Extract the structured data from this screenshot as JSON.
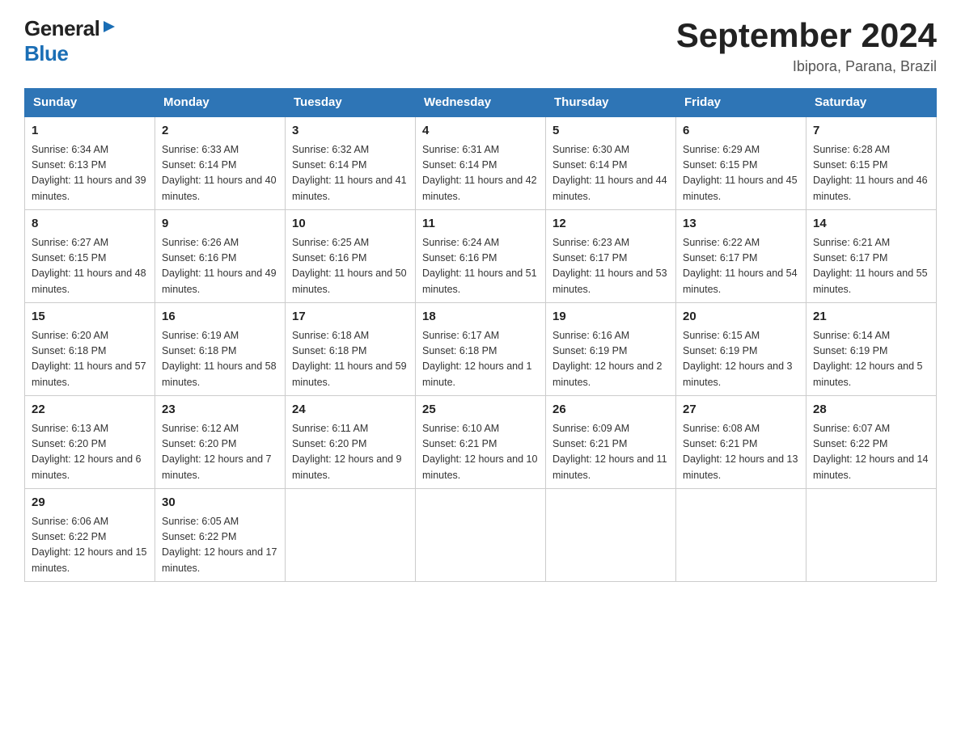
{
  "header": {
    "logo_general": "General",
    "logo_blue": "Blue",
    "main_title": "September 2024",
    "subtitle": "Ibipora, Parana, Brazil"
  },
  "weekdays": [
    "Sunday",
    "Monday",
    "Tuesday",
    "Wednesday",
    "Thursday",
    "Friday",
    "Saturday"
  ],
  "weeks": [
    [
      {
        "day": "1",
        "sunrise": "6:34 AM",
        "sunset": "6:13 PM",
        "daylight": "11 hours and 39 minutes."
      },
      {
        "day": "2",
        "sunrise": "6:33 AM",
        "sunset": "6:14 PM",
        "daylight": "11 hours and 40 minutes."
      },
      {
        "day": "3",
        "sunrise": "6:32 AM",
        "sunset": "6:14 PM",
        "daylight": "11 hours and 41 minutes."
      },
      {
        "day": "4",
        "sunrise": "6:31 AM",
        "sunset": "6:14 PM",
        "daylight": "11 hours and 42 minutes."
      },
      {
        "day": "5",
        "sunrise": "6:30 AM",
        "sunset": "6:14 PM",
        "daylight": "11 hours and 44 minutes."
      },
      {
        "day": "6",
        "sunrise": "6:29 AM",
        "sunset": "6:15 PM",
        "daylight": "11 hours and 45 minutes."
      },
      {
        "day": "7",
        "sunrise": "6:28 AM",
        "sunset": "6:15 PM",
        "daylight": "11 hours and 46 minutes."
      }
    ],
    [
      {
        "day": "8",
        "sunrise": "6:27 AM",
        "sunset": "6:15 PM",
        "daylight": "11 hours and 48 minutes."
      },
      {
        "day": "9",
        "sunrise": "6:26 AM",
        "sunset": "6:16 PM",
        "daylight": "11 hours and 49 minutes."
      },
      {
        "day": "10",
        "sunrise": "6:25 AM",
        "sunset": "6:16 PM",
        "daylight": "11 hours and 50 minutes."
      },
      {
        "day": "11",
        "sunrise": "6:24 AM",
        "sunset": "6:16 PM",
        "daylight": "11 hours and 51 minutes."
      },
      {
        "day": "12",
        "sunrise": "6:23 AM",
        "sunset": "6:17 PM",
        "daylight": "11 hours and 53 minutes."
      },
      {
        "day": "13",
        "sunrise": "6:22 AM",
        "sunset": "6:17 PM",
        "daylight": "11 hours and 54 minutes."
      },
      {
        "day": "14",
        "sunrise": "6:21 AM",
        "sunset": "6:17 PM",
        "daylight": "11 hours and 55 minutes."
      }
    ],
    [
      {
        "day": "15",
        "sunrise": "6:20 AM",
        "sunset": "6:18 PM",
        "daylight": "11 hours and 57 minutes."
      },
      {
        "day": "16",
        "sunrise": "6:19 AM",
        "sunset": "6:18 PM",
        "daylight": "11 hours and 58 minutes."
      },
      {
        "day": "17",
        "sunrise": "6:18 AM",
        "sunset": "6:18 PM",
        "daylight": "11 hours and 59 minutes."
      },
      {
        "day": "18",
        "sunrise": "6:17 AM",
        "sunset": "6:18 PM",
        "daylight": "12 hours and 1 minute."
      },
      {
        "day": "19",
        "sunrise": "6:16 AM",
        "sunset": "6:19 PM",
        "daylight": "12 hours and 2 minutes."
      },
      {
        "day": "20",
        "sunrise": "6:15 AM",
        "sunset": "6:19 PM",
        "daylight": "12 hours and 3 minutes."
      },
      {
        "day": "21",
        "sunrise": "6:14 AM",
        "sunset": "6:19 PM",
        "daylight": "12 hours and 5 minutes."
      }
    ],
    [
      {
        "day": "22",
        "sunrise": "6:13 AM",
        "sunset": "6:20 PM",
        "daylight": "12 hours and 6 minutes."
      },
      {
        "day": "23",
        "sunrise": "6:12 AM",
        "sunset": "6:20 PM",
        "daylight": "12 hours and 7 minutes."
      },
      {
        "day": "24",
        "sunrise": "6:11 AM",
        "sunset": "6:20 PM",
        "daylight": "12 hours and 9 minutes."
      },
      {
        "day": "25",
        "sunrise": "6:10 AM",
        "sunset": "6:21 PM",
        "daylight": "12 hours and 10 minutes."
      },
      {
        "day": "26",
        "sunrise": "6:09 AM",
        "sunset": "6:21 PM",
        "daylight": "12 hours and 11 minutes."
      },
      {
        "day": "27",
        "sunrise": "6:08 AM",
        "sunset": "6:21 PM",
        "daylight": "12 hours and 13 minutes."
      },
      {
        "day": "28",
        "sunrise": "6:07 AM",
        "sunset": "6:22 PM",
        "daylight": "12 hours and 14 minutes."
      }
    ],
    [
      {
        "day": "29",
        "sunrise": "6:06 AM",
        "sunset": "6:22 PM",
        "daylight": "12 hours and 15 minutes."
      },
      {
        "day": "30",
        "sunrise": "6:05 AM",
        "sunset": "6:22 PM",
        "daylight": "12 hours and 17 minutes."
      },
      null,
      null,
      null,
      null,
      null
    ]
  ]
}
